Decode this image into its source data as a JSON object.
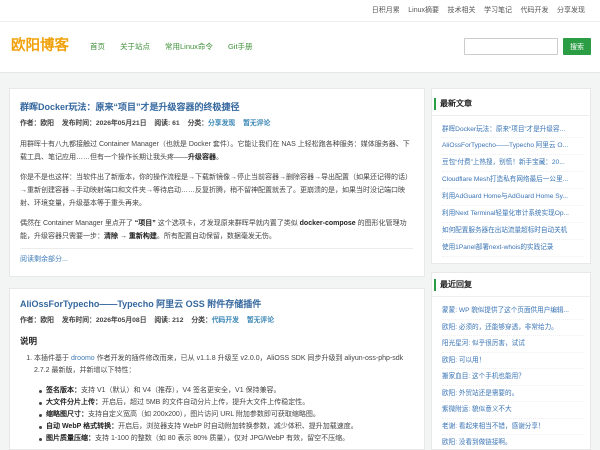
{
  "topbar": {
    "links": [
      "日积月累",
      "Linux摘要",
      "技术相关",
      "学习笔记",
      "代码开发",
      "分享发现"
    ]
  },
  "header": {
    "logo": "欧阳博客",
    "nav": [
      "首页",
      "关于站点",
      "常用Linux命令",
      "Git手册"
    ],
    "search_button": "搜索"
  },
  "posts": [
    {
      "title": "群晖Docker玩法：原来“项目”才是升级容器的终极捷径",
      "meta": {
        "author_label": "作者：",
        "author": "欧阳",
        "date_label": "发布时间：",
        "date": "2026年05月21日",
        "views_label": "阅读: ",
        "views": "61",
        "category_label": "分类：",
        "category": "分享发现",
        "comments": "暂无评论"
      },
      "paragraphs": [
        [
          "用群晖十有八九都接触过 Container Manager（也就是 Docker 套件）。它能让我们在 NAS 上轻松跑各种服务：媒体服务器、下载工具、笔记应用……但有一个操作长期让我头疼——",
          "升级容器",
          "。"
        ],
        [
          "你是不是也这样：当软件出了新版本，你的操作流程是→下载新镜像→停止当前容器→删除容器→导出配置（如果还记得的话）→重新创建容器→手动映射端口和文件夹→等待启动……反复折腾，稍不留神配置就丢了。更崩溃的是，如果当时没记端口映射、环境变量，升级基本等于重头再来。"
        ],
        [
          "偶然在 Container Manager 里点开了 ",
          "“项目”",
          " 这个选项卡，才发现原来群晖早就内置了类似 ",
          "docker-compose",
          " 的图形化管理功能，升级容器只需要一步：",
          "清除 → 重新构建",
          "。所有配置自动保留，数据毫发无伤。"
        ]
      ],
      "read_more": "阅读剩余部分..."
    },
    {
      "title": "AliOssForTypecho——Typecho 阿里云 OSS 附件存储插件",
      "meta": {
        "author_label": "作者：",
        "author": "欧阳",
        "date_label": "发布时间：",
        "date": "2026年05月08日",
        "views_label": "阅读: ",
        "views": "212",
        "category_label": "分类：",
        "category": "代码开发",
        "comments": "暂无评论"
      },
      "section_title": "说明",
      "intro": [
        "本插件基于 ",
        "droomo",
        " 作者开发的插件修改而来，已从 v1.1.8 升级至 v2.0.0，AliOSS SDK 同步升级到 aliyun-oss-php-sdk 2.7.2 最新版，并新增以下特性："
      ],
      "features": [
        {
          "label": "签名版本：",
          "text": "支持 V1（默认）和 V4（推荐），V4 签名更安全，V1 保持兼容。"
        },
        {
          "label": "大文件分片上传：",
          "text": "开启后，超过 5MB 的文件自动分片上传，提升大文件上传稳定性。"
        },
        {
          "label": "缩略图尺寸：",
          "text": "支持自定义宽高（如 200x200），图片访问 URL 附加参数即可获取缩略图。"
        },
        {
          "label": "自动 WebP 格式转换：",
          "text": "开启后，浏览器支持 WebP 时自动附加转换参数，减少体积、提升加载速度。"
        },
        {
          "label": "图片质量压缩：",
          "text": "支持 1-100 的整数（如 80 表示 80% 质量），仅对 JPG/WebP 有效，留空不压缩。"
        }
      ]
    }
  ],
  "sidebar": {
    "recent_posts": {
      "title": "最新文章",
      "items": [
        "群晖Docker玩法：原来“项目”才是升级容...",
        "AliOssForTypecho——Typecho 阿里云 O...",
        "豆包“付费”上热搜，别慌！新手宝藏：20...",
        "Cloudflare Mesh打造私有网络最后一公里...",
        "利用AdGuard Home与AdGuard Home Sy...",
        "利用Next Terminal轻量化审计系统实现Op...",
        "如何配置服务器在出站流量超标时自动关机",
        "使用1Panel部署next-whois的实践记录"
      ]
    },
    "recent_comments": {
      "title": "最近回复",
      "separator": ": ",
      "items": [
        {
          "author": "蒙蒙",
          "text": "WP 貌似提供了这个页面供用户编辑..."
        },
        {
          "author": "欧阳",
          "text": "必须的，还能够穿透，非常给力。"
        },
        {
          "author": "阳光星河",
          "text": "似乎很厉害，试试"
        },
        {
          "author": "欧阳",
          "text": "可以用！"
        },
        {
          "author": "搬家血目",
          "text": "这个手机也能用？"
        },
        {
          "author": "欧阳",
          "text": "外贸站还是需要的。"
        },
        {
          "author": "紫微附运",
          "text": "貌似意义不大"
        },
        {
          "author": "老谢",
          "text": "看起来相当不错，感谢分享！"
        },
        {
          "author": "欧阳",
          "text": "没看到做链接啊。"
        }
      ]
    }
  },
  "theme": {
    "accent_green": "#2b9e45",
    "nav_green": "#3f8f3a",
    "title_blue": "#34679e",
    "link_blue": "#3a74b4",
    "logo_orange": "#f0a20c",
    "page_background": "#f3f4f4"
  }
}
